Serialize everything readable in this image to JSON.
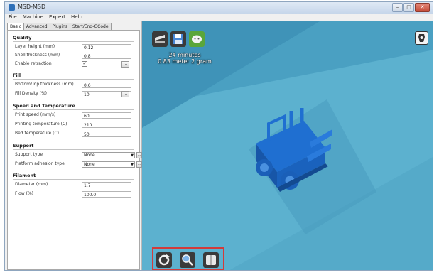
{
  "window": {
    "title": "MSD-MSD",
    "buttons": {
      "minimize": "–",
      "maximize": "□",
      "close": "✕"
    }
  },
  "menu": [
    "File",
    "Machine",
    "Expert",
    "Help"
  ],
  "tabs": [
    "Basic",
    "Advanced",
    "Plugins",
    "Start/End-GCode"
  ],
  "sections": {
    "quality": "Quality",
    "fill": "Fill",
    "speed": "Speed and Temperature",
    "support": "Support",
    "filament": "Filament"
  },
  "fields": {
    "layer_height": {
      "label": "Layer height (mm)",
      "value": "0.12"
    },
    "shell_thickness": {
      "label": "Shell thickness (mm)",
      "value": "0.8"
    },
    "enable_retraction": {
      "label": "Enable retraction",
      "value": "✓"
    },
    "bottom_top_thickness": {
      "label": "Bottom/Top thickness (mm)",
      "value": "0.6"
    },
    "fill_density": {
      "label": "Fill Density (%)",
      "value": "10"
    },
    "print_speed": {
      "label": "Print speed (mm/s)",
      "value": "60"
    },
    "printing_temperature": {
      "label": "Printing temperature (C)",
      "value": "210"
    },
    "bed_temperature": {
      "label": "Bed temperature (C)",
      "value": "50"
    },
    "support_type": {
      "label": "Support type",
      "value": "None"
    },
    "platform_adhesion": {
      "label": "Platform adhesion type",
      "value": "None"
    },
    "diameter": {
      "label": "Diameter (mm)",
      "value": "1.7"
    },
    "flow": {
      "label": "Flow (%)",
      "value": "100.0"
    }
  },
  "buttons": {
    "dots": "...",
    "dropdown_arrow": "▼"
  },
  "viewport": {
    "print_time": "24 minutes",
    "filament_usage": "0.83 meter 2 gram"
  },
  "icons": {
    "load": "load-model-icon",
    "save": "save-gcode-icon",
    "share": "share-icon",
    "view_mode": "view-mode-icon",
    "rotate": "rotate-icon",
    "scale": "scale-icon",
    "mirror": "mirror-icon"
  },
  "colors": {
    "viewport_bg": "#4ea3c4",
    "model": "#1f6fd1",
    "toolbar_highlight": "#d23b3b"
  }
}
